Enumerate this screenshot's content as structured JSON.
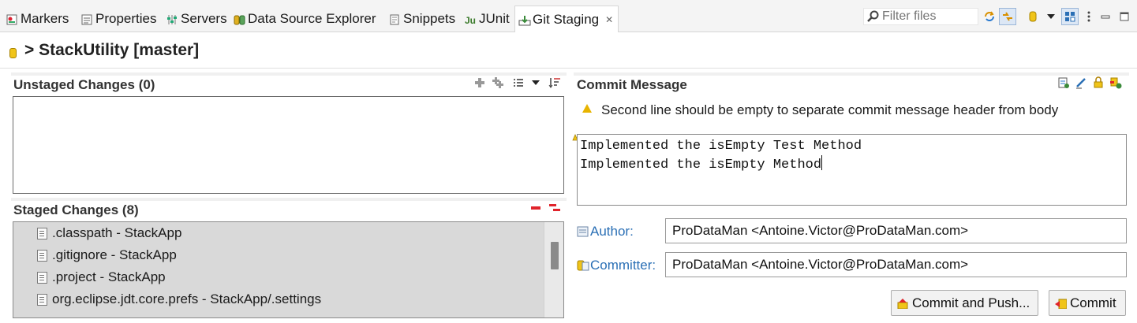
{
  "tabs": [
    {
      "label": "Markers",
      "icon": "markers-icon"
    },
    {
      "label": "Properties",
      "icon": "properties-icon"
    },
    {
      "label": "Servers",
      "icon": "servers-icon"
    },
    {
      "label": "Data Source Explorer",
      "icon": "data-source-explorer-icon"
    },
    {
      "label": "Snippets",
      "icon": "snippets-icon"
    },
    {
      "label": "JUnit",
      "icon": "junit-icon"
    },
    {
      "label": "Git Staging",
      "icon": "git-staging-icon",
      "active": true
    }
  ],
  "toolbar": {
    "filter_placeholder": "Filter files"
  },
  "repository": {
    "title": "> StackUtility [master]"
  },
  "unstaged": {
    "title": "Unstaged Changes (0)"
  },
  "staged": {
    "title": "Staged Changes (8)",
    "files": [
      ".classpath - StackApp",
      ".gitignore - StackApp",
      ".project - StackApp",
      "org.eclipse.jdt.core.prefs - StackApp/.settings"
    ]
  },
  "commit": {
    "title": "Commit Message",
    "warning": "Second line should be empty to separate commit message header from body",
    "message_line1": "Implemented the isEmpty Test Method",
    "message_line2": "Implemented the isEmpty Method",
    "author_label": "Author:",
    "author_value": "ProDataMan <Antoine.Victor@ProDataMan.com>",
    "committer_label": "Committer:",
    "committer_value": "ProDataMan <Antoine.Victor@ProDataMan.com>",
    "commit_and_push_label": "Commit and Push...",
    "commit_label": "Commit"
  },
  "colors": {
    "accent_link": "#2a6fb5",
    "staged_bg": "#d9d9d9",
    "warning": "#e8b400",
    "remove": "#e0242b"
  }
}
